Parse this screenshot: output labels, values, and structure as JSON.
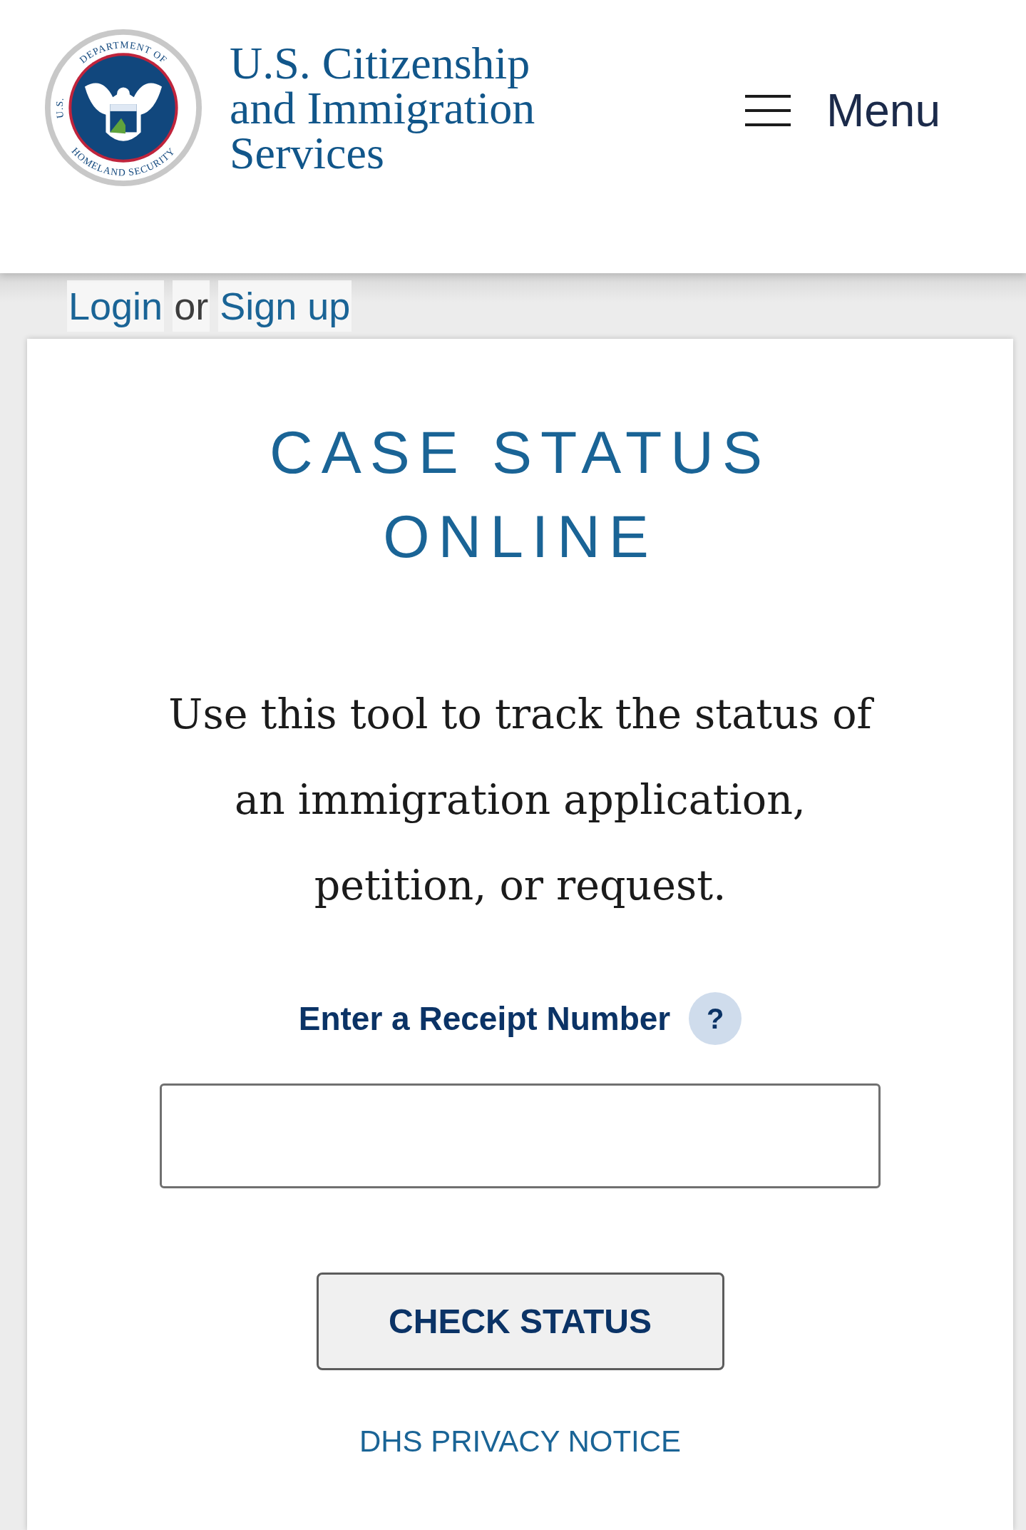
{
  "header": {
    "seal": {
      "top": "DEPARTMENT OF",
      "left": "U.S.",
      "bottom": "HOMELAND SECURITY"
    },
    "agency_lines": [
      "U.S. Citizenship",
      "and Immigration",
      "Services"
    ],
    "menu_label": "Menu"
  },
  "account_bar": {
    "login": "Login",
    "separator": "or",
    "signup": "Sign up"
  },
  "card": {
    "title": "CASE STATUS ONLINE",
    "intro": "Use this tool to track the status of an immigration application, petition, or request.",
    "field_label": "Enter a Receipt Number",
    "help": "?",
    "button": "CHECK STATUS",
    "privacy_link": "DHS PRIVACY NOTICE"
  }
}
